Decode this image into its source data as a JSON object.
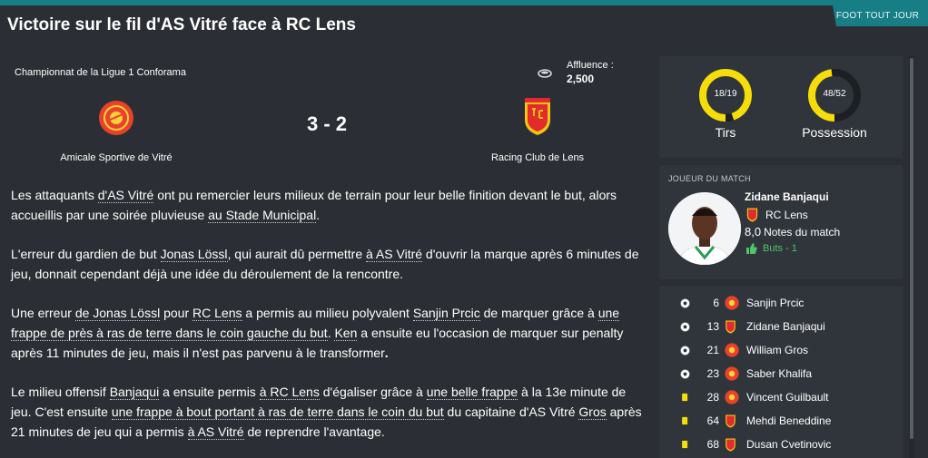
{
  "source": "FOOT TOUT JOUR",
  "headline": "Victoire sur le fil d'AS Vitré face à RC Lens",
  "match": {
    "competition": "Championnat de la Ligue 1 Conforama",
    "attendance_label": "Affluence :",
    "attendance_value": "2,500",
    "score": "3 - 2",
    "home_team": "Amicale Sportive de Vitré",
    "away_team": "Racing Club de Lens",
    "colors": {
      "home": "#e8432a",
      "away": "#e32b2b",
      "away_gold": "#f2c418"
    }
  },
  "report": {
    "p1": [
      "Les attaquants ",
      "d'AS Vitré",
      " ont pu remercier leurs milieux de terrain pour leur belle finition devant le but, alors accueillis par une soirée pluvieuse ",
      "au Stade Municipal",
      "."
    ],
    "p2": [
      "L'erreur du gardien de but ",
      "Jonas Lössl",
      ", qui aurait dû permettre ",
      "à AS Vitré",
      " d'ouvrir la marque après 6 minutes de jeu, donnait cependant déjà une idée du déroulement de la rencontre."
    ],
    "p3": [
      "Une erreur ",
      "de Jonas Lössl",
      " pour ",
      "RC Lens",
      " a permis au milieu polyvalent ",
      "Sanjin Prcic",
      " de marquer grâce à ",
      "une frappe de près à ras de terre dans le coin gauche du but",
      ". ",
      "Ken",
      " a ensuite eu l'occasion de marquer sur penalty après 11 minutes de jeu, mais il n'est pas parvenu à le transformer",
      "."
    ],
    "p4": [
      "Le milieu offensif ",
      "Banjaqui",
      " a ensuite permis ",
      "à RC Lens",
      " d'égaliser grâce à ",
      "une belle frappe",
      " à la 13e minute de jeu. C'est ensuite ",
      "une frappe à bout portant à ras de terre dans le coin du but",
      " du capitaine d'AS Vitré ",
      "Gros",
      " après 21 minutes de jeu qui a permis ",
      "à AS Vitré",
      " de reprendre l'avantage."
    ]
  },
  "stats": [
    {
      "text": "18/19",
      "label": "Tirs",
      "home_fraction": 0.947
    },
    {
      "text": "48/52",
      "label": "Possession",
      "home_fraction": 0.48
    }
  ],
  "stats_colors": {
    "home": "#f5dd0a",
    "away": "#1c1f23"
  },
  "potm": {
    "title": "JOUEUR DU MATCH",
    "name": "Zidane Banjaqui",
    "club": "RC Lens",
    "rating": "8,0",
    "rating_label": "Notes du match",
    "goals": "Buts - 1"
  },
  "events": [
    {
      "type": "goal",
      "icon": "ball-icon",
      "minute": "6",
      "team": "home",
      "player": "Sanjin Prcic"
    },
    {
      "type": "goal",
      "icon": "ball-icon",
      "minute": "13",
      "team": "away",
      "player": "Zidane Banjaqui"
    },
    {
      "type": "goal",
      "icon": "ball-icon",
      "minute": "21",
      "team": "home",
      "player": "William Gros"
    },
    {
      "type": "goal",
      "icon": "ball-icon",
      "minute": "23",
      "team": "home",
      "player": "Saber Khalifa"
    },
    {
      "type": "card",
      "icon": "yellow-card-icon",
      "minute": "28",
      "team": "home",
      "player": "Vincent Guilbault"
    },
    {
      "type": "card",
      "icon": "yellow-card-icon",
      "minute": "64",
      "team": "away",
      "player": "Mehdi Beneddine"
    },
    {
      "type": "card",
      "icon": "yellow-card-icon",
      "minute": "68",
      "team": "away",
      "player": "Dusan Cvetinovic"
    }
  ]
}
